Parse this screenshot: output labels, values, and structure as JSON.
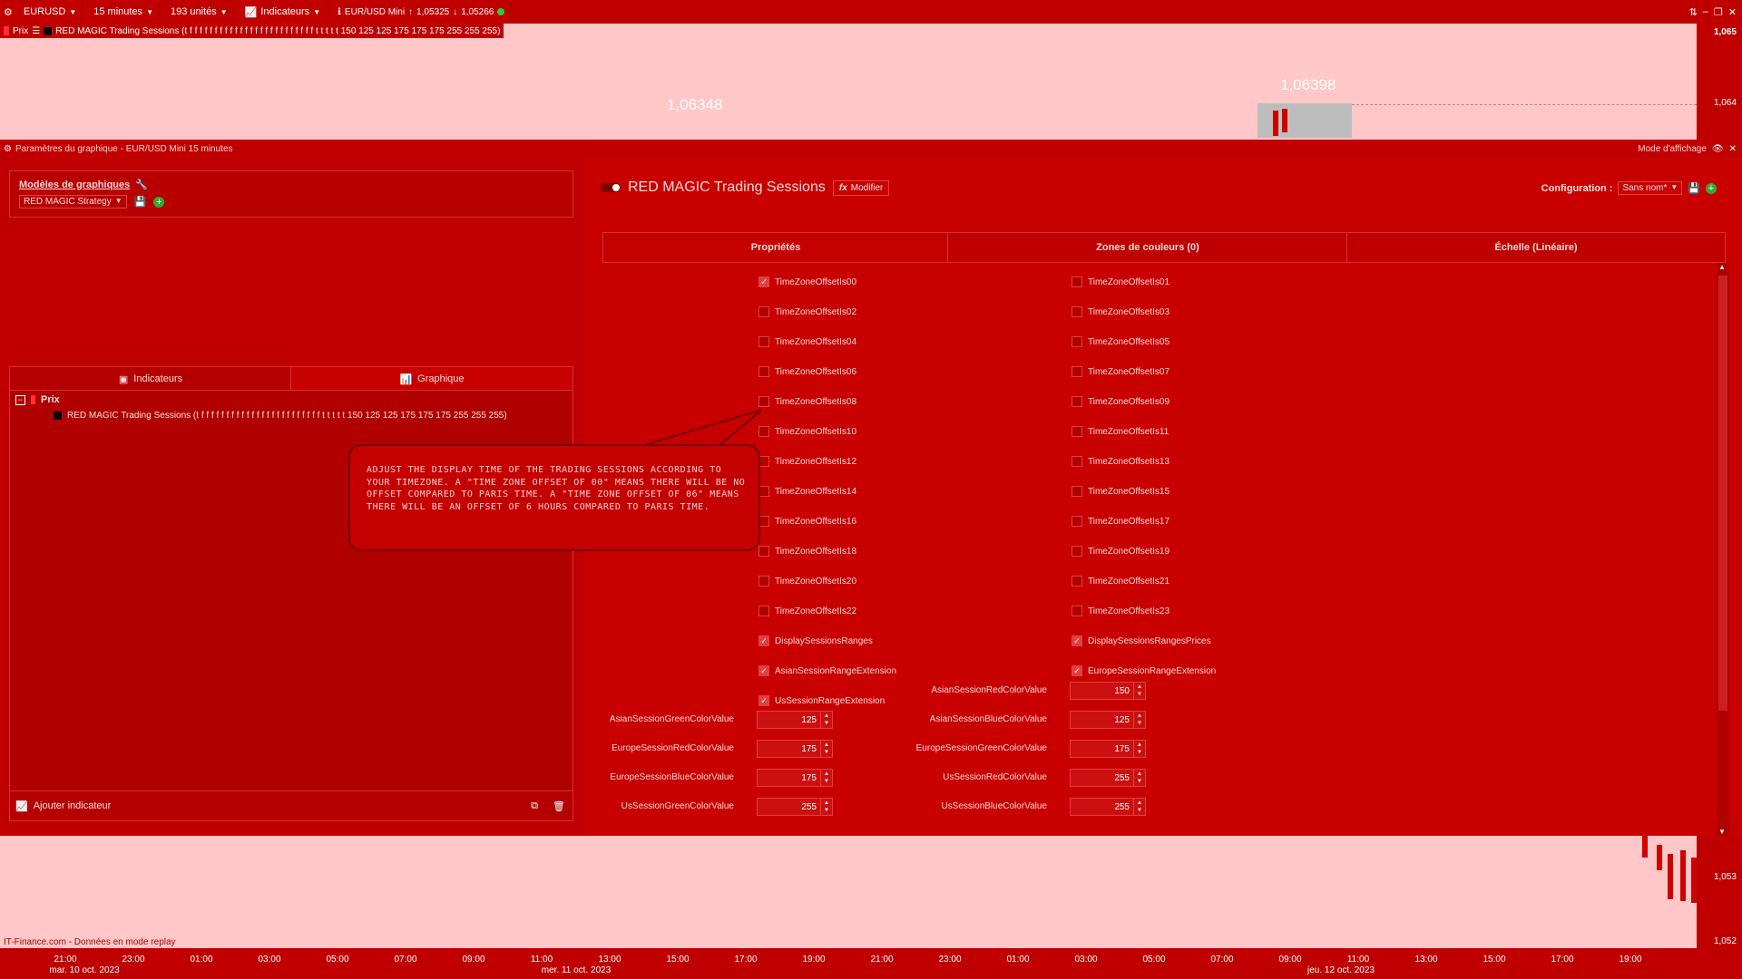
{
  "toolbar": {
    "symbol": "EURUSD",
    "timeframe": "15 minutes",
    "units": "193 unités",
    "indicators": "Indicateurs",
    "instrument": "EUR/USD Mini",
    "price_up": "1,05325",
    "price_down": "1,05266"
  },
  "legend": {
    "prix": "Prix",
    "indicator_line": "RED MAGIC Trading Sessions (t f f f f f f f f f f f f f f f f f f f f f f f f f t t t t t 150 125 125 175 175 175 255 255 255)"
  },
  "chart": {
    "price_label_left": "1,06348",
    "price_label_right": "1,06398",
    "y_ticks": [
      "1,065",
      "1,064",
      "1,053",
      "1,052"
    ],
    "footer_note": "IT-Finance.com - Données en mode replay",
    "x_ticks": [
      "21:00",
      "23:00",
      "01:00",
      "03:00",
      "05:00",
      "07:00",
      "09:00",
      "11:00",
      "13:00",
      "15:00",
      "17:00",
      "19:00",
      "21:00",
      "23:00",
      "01:00",
      "03:00",
      "05:00",
      "07:00",
      "09:00",
      "11:00",
      "13:00",
      "15:00",
      "17:00",
      "19:00"
    ],
    "x_dates": [
      "mar. 10 oct. 2023",
      "mer. 11 oct. 2023",
      "jeu. 12 oct. 2023"
    ]
  },
  "dialog": {
    "title": "Paramètres du graphique - EUR/USD Mini 15 minutes",
    "display_mode": "Mode d'affichage",
    "models_title": "Modèles de graphiques",
    "model_selected": "RED MAGIC Strategy",
    "tab_indicators": "Indicateurs",
    "tab_graph": "Graphique",
    "tree_root": "Prix",
    "tree_item": "RED MAGIC Trading Sessions (t f f f f f f f f f f f f f f f f f f f f f f f f t t t t t 150 125 125 175 175 175 255 255 255)",
    "add_indicator": "Ajouter indicateur",
    "indicator_name": "RED MAGIC Trading Sessions",
    "modify": "Modifier",
    "config_label": "Configuration :",
    "config_value": "Sans nom*",
    "tabs": [
      "Propriétés",
      "Zones de couleurs (0)",
      "Échelle (Linéaire)"
    ],
    "checkboxes_left": [
      {
        "label": "TimeZoneOffsetIs00",
        "checked": true
      },
      {
        "label": "TimeZoneOffsetIs02",
        "checked": false
      },
      {
        "label": "TimeZoneOffsetIs04",
        "checked": false
      },
      {
        "label": "TimeZoneOffsetIs06",
        "checked": false
      },
      {
        "label": "TimeZoneOffsetIs08",
        "checked": false
      },
      {
        "label": "TimeZoneOffsetIs10",
        "checked": false
      },
      {
        "label": "TimeZoneOffsetIs12",
        "checked": false
      },
      {
        "label": "TimeZoneOffsetIs14",
        "checked": false
      },
      {
        "label": "TimeZoneOffsetIs16",
        "checked": false
      },
      {
        "label": "TimeZoneOffsetIs18",
        "checked": false
      },
      {
        "label": "TimeZoneOffsetIs20",
        "checked": false
      },
      {
        "label": "TimeZoneOffsetIs22",
        "checked": false
      },
      {
        "label": "DisplaySessionsRanges",
        "checked": true
      },
      {
        "label": "AsianSessionRangeExtension",
        "checked": true
      },
      {
        "label": "UsSessionRangeExtension",
        "checked": true
      }
    ],
    "checkboxes_right": [
      {
        "label": "TimeZoneOffsetIs01",
        "checked": false
      },
      {
        "label": "TimeZoneOffsetIs03",
        "checked": false
      },
      {
        "label": "TimeZoneOffsetIs05",
        "checked": false
      },
      {
        "label": "TimeZoneOffsetIs07",
        "checked": false
      },
      {
        "label": "TimeZoneOffsetIs09",
        "checked": false
      },
      {
        "label": "TimeZoneOffsetIs11",
        "checked": false
      },
      {
        "label": "TimeZoneOffsetIs13",
        "checked": false
      },
      {
        "label": "TimeZoneOffsetIs15",
        "checked": false
      },
      {
        "label": "TimeZoneOffsetIs17",
        "checked": false
      },
      {
        "label": "TimeZoneOffsetIs19",
        "checked": false
      },
      {
        "label": "TimeZoneOffsetIs21",
        "checked": false
      },
      {
        "label": "TimeZoneOffsetIs23",
        "checked": false
      },
      {
        "label": "DisplaySessionsRangesPrices",
        "checked": true
      },
      {
        "label": "EuropeSessionRangeExtension",
        "checked": true
      }
    ],
    "numbers_left": [
      {
        "label": "AsianSessionGreenColorValue",
        "value": "125"
      },
      {
        "label": "EuropeSessionRedColorValue",
        "value": "175"
      },
      {
        "label": "EuropeSessionBlueColorValue",
        "value": "175"
      },
      {
        "label": "UsSessionGreenColorValue",
        "value": "255"
      }
    ],
    "numbers_right": [
      {
        "label": "AsianSessionRedColorValue",
        "value": "150"
      },
      {
        "label": "AsianSessionBlueColorValue",
        "value": "125"
      },
      {
        "label": "EuropeSessionGreenColorValue",
        "value": "175"
      },
      {
        "label": "UsSessionRedColorValue",
        "value": "255"
      },
      {
        "label": "UsSessionBlueColorValue",
        "value": "255"
      }
    ]
  },
  "callout": {
    "text": "ADJUST THE DISPLAY TIME OF THE TRADING SESSIONS ACCORDING TO YOUR TIMEZONE. A \"TIME ZONE OFFSET OF 00\" MEANS THERE WILL BE NO OFFSET COMPARED TO PARIS TIME. A \"TIME ZONE OFFSET OF 06\" MEANS THERE WILL BE AN OFFSET OF 6 HOURS COMPARED TO PARIS TIME."
  }
}
